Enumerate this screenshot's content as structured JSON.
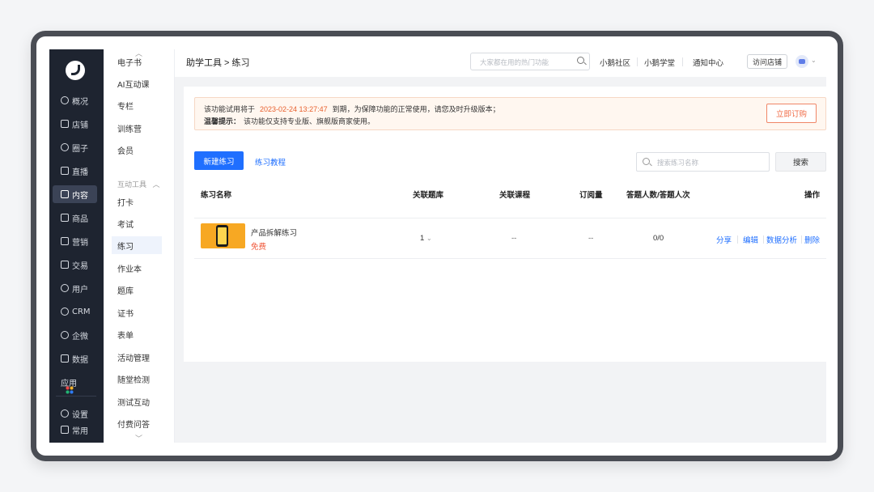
{
  "nav": {
    "items": [
      {
        "label": "概况",
        "icon": "overview-icon"
      },
      {
        "label": "店铺",
        "icon": "store-icon"
      },
      {
        "label": "圈子",
        "icon": "circle-icon"
      },
      {
        "label": "直播",
        "icon": "live-icon"
      },
      {
        "label": "内容",
        "icon": "content-icon",
        "active": true
      },
      {
        "label": "商品",
        "icon": "goods-icon"
      },
      {
        "label": "营销",
        "icon": "marketing-icon"
      },
      {
        "label": "交易",
        "icon": "trade-icon"
      },
      {
        "label": "用户",
        "icon": "user-icon"
      },
      {
        "label": "CRM",
        "icon": "crm-icon"
      },
      {
        "label": "企微",
        "icon": "wecom-icon"
      },
      {
        "label": "数据",
        "icon": "data-icon"
      },
      {
        "label": "应用",
        "icon": "apps-icon"
      }
    ],
    "bottom_items": [
      {
        "label": "设置",
        "icon": "settings-icon"
      },
      {
        "label": "常用",
        "icon": "favorites-icon"
      }
    ]
  },
  "subnav": {
    "top_items": [
      "电子书",
      "AI互动课",
      "专栏",
      "训练营",
      "会员"
    ],
    "group_title": "互动工具",
    "group_items": [
      "打卡",
      "考试",
      "练习",
      "作业本",
      "题库",
      "证书",
      "表单",
      "活动管理",
      "随堂检测",
      "测试互动",
      "付费问答"
    ],
    "active": "练习"
  },
  "header": {
    "breadcrumb": "助学工具 > 练习",
    "search_placeholder": "大家都在用的热门功能",
    "links": [
      "小鹅社区",
      "小鹅学堂",
      "通知中心"
    ],
    "visit_store": "访问店铺"
  },
  "notice": {
    "prefix": "该功能试用将于",
    "date": "2023-02-24 13:27:47",
    "suffix": "到期，为保障功能的正常使用，请您及时升级版本；",
    "tip_label": "温馨提示：",
    "tip_text": "该功能仅支持专业版、旗舰版商家使用。",
    "button": "立即订购"
  },
  "toolbar": {
    "new_button": "新建练习",
    "tutorial_link": "练习教程",
    "filter_placeholder": "搜索练习名称",
    "search_button": "搜索"
  },
  "table": {
    "headers": [
      "练习名称",
      "关联题库",
      "关联课程",
      "订阅量",
      "答题人数/答题人次",
      "操作"
    ],
    "rows": [
      {
        "name": "产品拆解练习",
        "price": "免费",
        "question_bank": "1",
        "course": "--",
        "subscriptions": "--",
        "answers": "0/0",
        "actions": [
          "分享",
          "编辑",
          "数据分析",
          "删除"
        ]
      }
    ]
  }
}
